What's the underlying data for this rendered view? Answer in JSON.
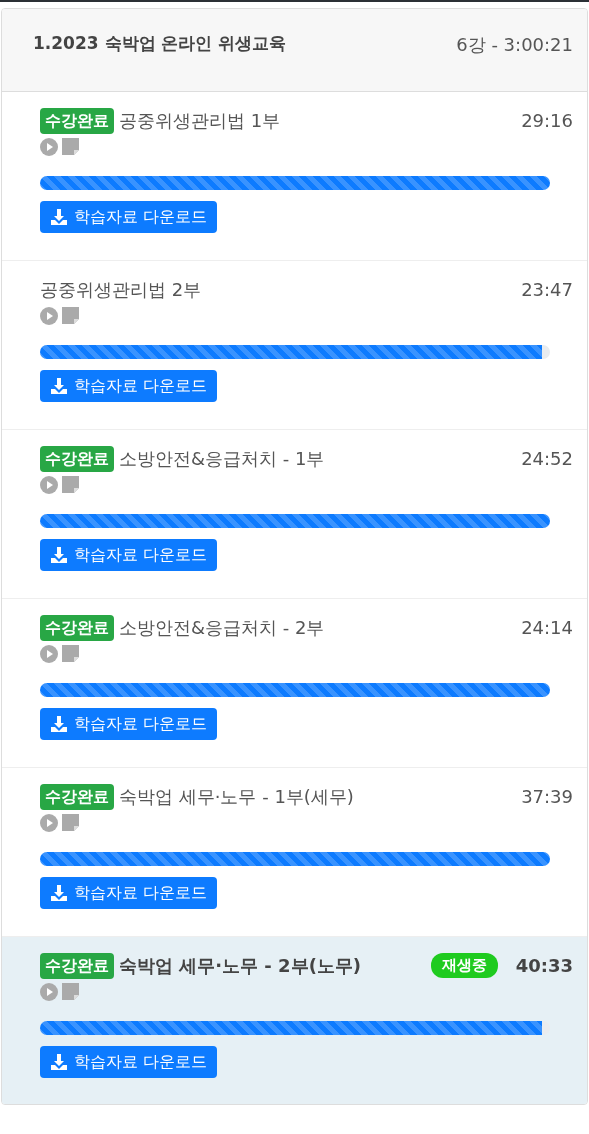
{
  "course": {
    "title": "1.2023 숙박업 온라인 위생교육",
    "summary": "6강 - 3:00:21"
  },
  "lessons": [
    {
      "title": "공중위생관리법 1부",
      "duration": "29:16",
      "completed": true,
      "completed_label": "수강완료",
      "playing": false,
      "level": 1,
      "download": "학습자료 다운로드"
    },
    {
      "title": "공중위생관리법 2부",
      "duration": "23:47",
      "completed": false,
      "playing": false,
      "level": 0.985,
      "download": "학습자료 다운로드"
    },
    {
      "title": "소방안전&응급처치 - 1부",
      "duration": "24:52",
      "completed": true,
      "completed_label": "수강완료",
      "playing": false,
      "level": 1,
      "download": "학습자료 다운로드"
    },
    {
      "title": "소방안전&응급처치 - 2부",
      "duration": "24:14",
      "completed": true,
      "completed_label": "수강완료",
      "playing": false,
      "level": 1,
      "download": "학습자료 다운로드"
    },
    {
      "title": "숙박업 세무·노무 - 1부(세무)",
      "duration": "37:39",
      "completed": true,
      "completed_label": "수강완료",
      "playing": false,
      "level": 1,
      "download": "학습자료 다운로드"
    },
    {
      "title": "숙박업 세무·노무 - 2부(노무)",
      "duration": "40:33",
      "completed": true,
      "completed_label": "수강완료",
      "playing": true,
      "playing_label": "재생중",
      "level": 0.985,
      "download": "학습자료 다운로드"
    }
  ]
}
